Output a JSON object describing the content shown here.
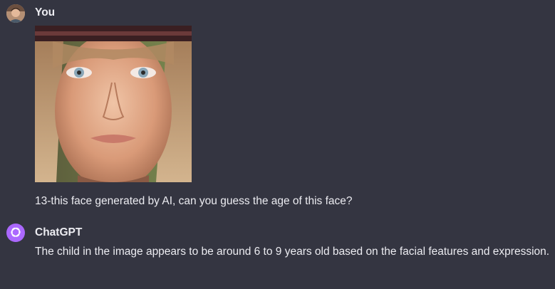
{
  "conversation": {
    "user_message": {
      "author": "You",
      "text": "13-this face generated by AI, can you guess the age of this face?",
      "avatar_icon": "user-avatar",
      "attachment_icon": "face-photo"
    },
    "assistant_message": {
      "author": "ChatGPT",
      "text": "The child in the image appears to be around 6 to 9 years old based on the facial features and expression.",
      "avatar_icon": "openai-logo-icon",
      "avatar_color": "#ab68ff"
    }
  }
}
